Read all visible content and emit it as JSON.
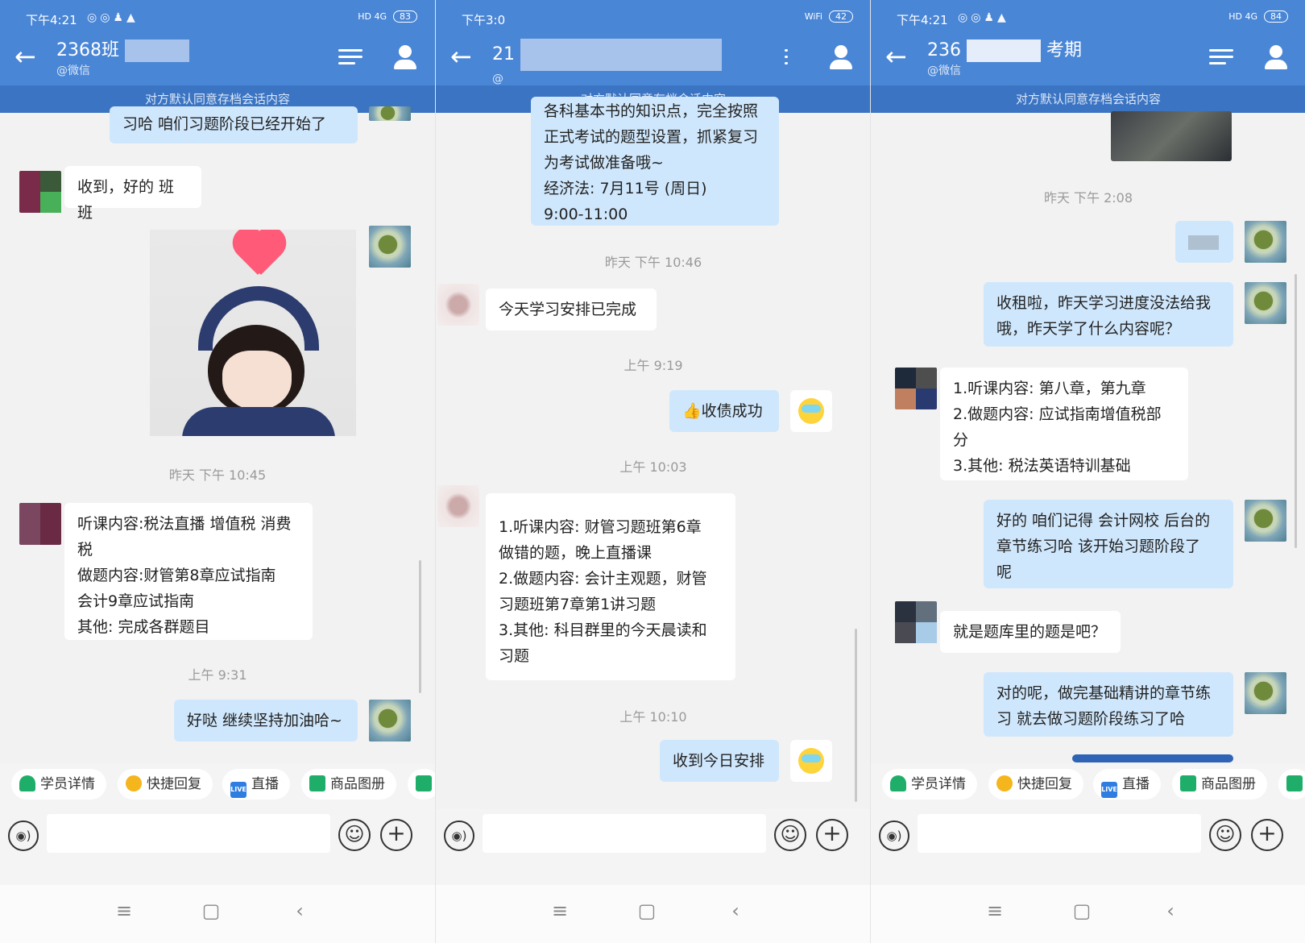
{
  "screens": [
    {
      "status_time": "下午4:21",
      "status_icons": "◎◎♟▲",
      "network": "HD 4G",
      "battery": "83",
      "title_prefix": "2368班",
      "title_suffix": "",
      "subtitle": "@微信",
      "notice": "对方默认同意存档会话内容",
      "messages": [
        {
          "text": "习哈  咱们习题阶段已经开始了"
        },
        {
          "text": "收到，好的 班班"
        },
        {
          "text": "昨天  下午 10:45"
        },
        {
          "text": "听课内容:税法直播 增值税 消费\n税\n做题内容:财管第8章应试指南\n            会计9章应试指南\n其他: 完成各群题目"
        },
        {
          "text": "上午 9:31"
        },
        {
          "text": "好哒 继续坚持加油哈~"
        }
      ],
      "quick_actions": [
        "学员详情",
        "快捷回复",
        "直播",
        "商品图册"
      ],
      "input_placeholder": ""
    },
    {
      "status_time": "下午3:0",
      "status_icons": "",
      "network": "WiFi",
      "battery": "42",
      "title_prefix": "21",
      "title_suffix": "",
      "subtitle": "@",
      "notice": "对方默认同意存档会话内容",
      "messages": [
        {
          "text": "各科基本书的知识点，完全按照\n正式考试的题型设置，抓紧复习\n为考试做准备哦~\n        经济法: 7月11号 (周日)\n9:00-11:00"
        },
        {
          "text": "昨天  下午 10:46"
        },
        {
          "text": "今天学习安排已完成"
        },
        {
          "text": "上午 9:19"
        },
        {
          "text": "👍收债成功"
        },
        {
          "text": "上午 10:03"
        },
        {
          "text": "1.听课内容: 财管习题班第6章\n做错的题，晚上直播课\n2.做题内容: 会计主观题，财管\n习题班第7章第1讲习题\n3.其他: 科目群里的今天晨读和\n习题"
        },
        {
          "text": "上午 10:10"
        },
        {
          "text": "收到今日安排"
        }
      ],
      "input_placeholder": ""
    },
    {
      "status_time": "下午4:21",
      "status_icons": "◎◎♟▲",
      "network": "HD 4G",
      "battery": "84",
      "title_prefix": "236",
      "title_suffix": "考期",
      "subtitle": "@微信",
      "notice": "对方默认同意存档会话内容",
      "messages": [
        {
          "text": "昨天  下午 2:08"
        },
        {
          "text": "收租啦，昨天学习进度没法给我\n哦，昨天学了什么内容呢？"
        },
        {
          "text": "1.听课内容: 第八章，第九章\n2.做题内容: 应试指南增值税部\n分\n3.其他: 税法英语特训基础"
        },
        {
          "text": "好的 咱们记得 会计网校 后台的\n章节练习哈  该开始习题阶段了\n呢"
        },
        {
          "text": "就是题库里的题是吧？"
        },
        {
          "text": "对的呢，做完基础精讲的章节练\n习 就去做习题阶段练习了哈"
        }
      ],
      "quick_actions": [
        "学员详情",
        "快捷回复",
        "直播",
        "商品图册"
      ],
      "input_placeholder": ""
    }
  ],
  "icons": {
    "back": "arrow-left-icon",
    "menu": "list-menu-icon",
    "profile": "person-icon",
    "voice": "voice-icon",
    "emoji": "emoji-icon",
    "plus": "plus-icon",
    "nav_menu": "≡",
    "nav_home": "▢",
    "nav_back": "‹"
  },
  "colors": {
    "header_blue": "#4a86d6",
    "notice_blue": "#3b74c2",
    "bubble_out": "#cfe7fc",
    "bubble_in": "#ffffff"
  }
}
